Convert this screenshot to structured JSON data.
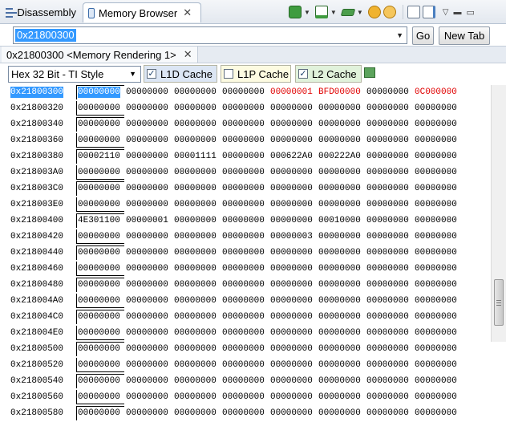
{
  "tabs": {
    "disassembly": "Disassembly",
    "memory_browser": "Memory Browser"
  },
  "toolbar": {
    "icons": [
      "chip-icon",
      "memory-view-icon",
      "memory-map-icon",
      "sync-forward-icon",
      "sync-back-icon",
      "new-view-icon",
      "edit-icon",
      "view-menu-icon",
      "minimize-icon",
      "maximize-icon"
    ]
  },
  "address": {
    "value": "0x21800300",
    "go_label": "Go",
    "new_tab_label": "New Tab"
  },
  "rendering_tab": {
    "label": "0x21800300 <Memory Rendering 1>"
  },
  "options": {
    "format": "Hex 32 Bit - TI Style",
    "caches": [
      {
        "label": "L1D Cache",
        "checked": true,
        "color": "#dce6f4"
      },
      {
        "label": "L1P Cache",
        "checked": false,
        "color": "#fdfbe1"
      },
      {
        "label": "L2 Cache",
        "checked": true,
        "color": "#e1f2db"
      }
    ]
  },
  "colors": {
    "selection": "#3399ff",
    "changed": "#e00000"
  },
  "memory": {
    "rows": [
      {
        "addr": "0x21800300",
        "words": [
          "00000000",
          "00000000",
          "00000000",
          "00000000",
          "00000001",
          "BFD00000",
          "00000000",
          "0C000000"
        ],
        "changed": [
          4,
          5,
          7
        ],
        "selected": true,
        "bracket": "top"
      },
      {
        "addr": "0x21800320",
        "words": [
          "00000000",
          "00000000",
          "00000000",
          "00000000",
          "00000000",
          "00000000",
          "00000000",
          "00000000"
        ],
        "bracket": "bot"
      },
      {
        "addr": "0x21800340",
        "words": [
          "00000000",
          "00000000",
          "00000000",
          "00000000",
          "00000000",
          "00000000",
          "00000000",
          "00000000"
        ],
        "bracket": "top"
      },
      {
        "addr": "0x21800360",
        "words": [
          "00000000",
          "00000000",
          "00000000",
          "00000000",
          "00000000",
          "00000000",
          "00000000",
          "00000000"
        ],
        "bracket": "bot"
      },
      {
        "addr": "0x21800380",
        "words": [
          "00002110",
          "00000000",
          "00001111",
          "00000000",
          "000622A0",
          "000222A0",
          "00000000",
          "00000000"
        ],
        "bracket": "top"
      },
      {
        "addr": "0x218003A0",
        "words": [
          "00000000",
          "00000000",
          "00000000",
          "00000000",
          "00000000",
          "00000000",
          "00000000",
          "00000000"
        ],
        "bracket": "bot"
      },
      {
        "addr": "0x218003C0",
        "words": [
          "00000000",
          "00000000",
          "00000000",
          "00000000",
          "00000000",
          "00000000",
          "00000000",
          "00000000"
        ],
        "bracket": "top"
      },
      {
        "addr": "0x218003E0",
        "words": [
          "00000000",
          "00000000",
          "00000000",
          "00000000",
          "00000000",
          "00000000",
          "00000000",
          "00000000"
        ],
        "bracket": "bot"
      },
      {
        "addr": "0x21800400",
        "words": [
          "4E301100",
          "00000001",
          "00000000",
          "00000000",
          "00000000",
          "00010000",
          "00000000",
          "00000000"
        ],
        "bracket": "top"
      },
      {
        "addr": "0x21800420",
        "words": [
          "00000000",
          "00000000",
          "00000000",
          "00000000",
          "00000003",
          "00000000",
          "00000000",
          "00000000"
        ],
        "bracket": "bot"
      },
      {
        "addr": "0x21800440",
        "words": [
          "00000000",
          "00000000",
          "00000000",
          "00000000",
          "00000000",
          "00000000",
          "00000000",
          "00000000"
        ],
        "bracket": "top"
      },
      {
        "addr": "0x21800460",
        "words": [
          "00000000",
          "00000000",
          "00000000",
          "00000000",
          "00000000",
          "00000000",
          "00000000",
          "00000000"
        ],
        "bracket": "bot"
      },
      {
        "addr": "0x21800480",
        "words": [
          "00000000",
          "00000000",
          "00000000",
          "00000000",
          "00000000",
          "00000000",
          "00000000",
          "00000000"
        ],
        "bracket": "top"
      },
      {
        "addr": "0x218004A0",
        "words": [
          "00000000",
          "00000000",
          "00000000",
          "00000000",
          "00000000",
          "00000000",
          "00000000",
          "00000000"
        ],
        "bracket": "bot"
      },
      {
        "addr": "0x218004C0",
        "words": [
          "00000000",
          "00000000",
          "00000000",
          "00000000",
          "00000000",
          "00000000",
          "00000000",
          "00000000"
        ],
        "bracket": "top"
      },
      {
        "addr": "0x218004E0",
        "words": [
          "00000000",
          "00000000",
          "00000000",
          "00000000",
          "00000000",
          "00000000",
          "00000000",
          "00000000"
        ],
        "bracket": "bot"
      },
      {
        "addr": "0x21800500",
        "words": [
          "00000000",
          "00000000",
          "00000000",
          "00000000",
          "00000000",
          "00000000",
          "00000000",
          "00000000"
        ],
        "bracket": "top"
      },
      {
        "addr": "0x21800520",
        "words": [
          "00000000",
          "00000000",
          "00000000",
          "00000000",
          "00000000",
          "00000000",
          "00000000",
          "00000000"
        ],
        "bracket": "bot"
      },
      {
        "addr": "0x21800540",
        "words": [
          "00000000",
          "00000000",
          "00000000",
          "00000000",
          "00000000",
          "00000000",
          "00000000",
          "00000000"
        ],
        "bracket": "top"
      },
      {
        "addr": "0x21800560",
        "words": [
          "00000000",
          "00000000",
          "00000000",
          "00000000",
          "00000000",
          "00000000",
          "00000000",
          "00000000"
        ],
        "bracket": "bot"
      },
      {
        "addr": "0x21800580",
        "words": [
          "00000000",
          "00000000",
          "00000000",
          "00000000",
          "00000000",
          "00000000",
          "00000000",
          "00000000"
        ],
        "bracket": "top"
      }
    ]
  }
}
